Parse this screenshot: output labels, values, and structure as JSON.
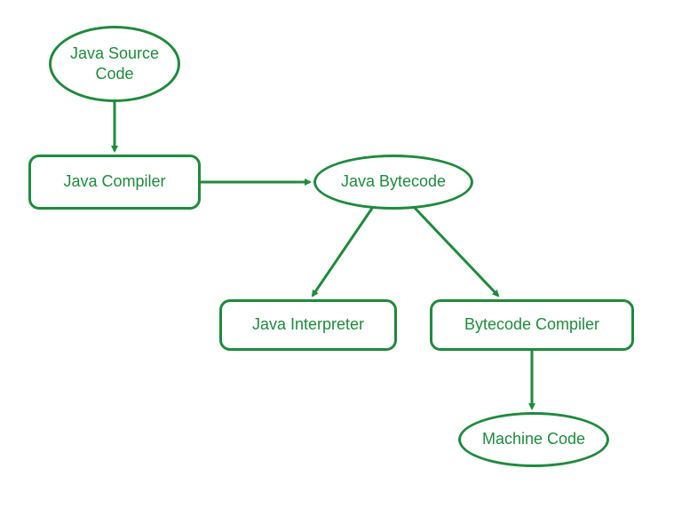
{
  "color": "#1f8a3d",
  "nodes": {
    "source": "Java Source\nCode",
    "compiler": "Java Compiler",
    "bytecode": "Java Bytecode",
    "interpreter": "Java Interpreter",
    "bcCompiler": "Bytecode Compiler",
    "machine": "Machine Code"
  }
}
